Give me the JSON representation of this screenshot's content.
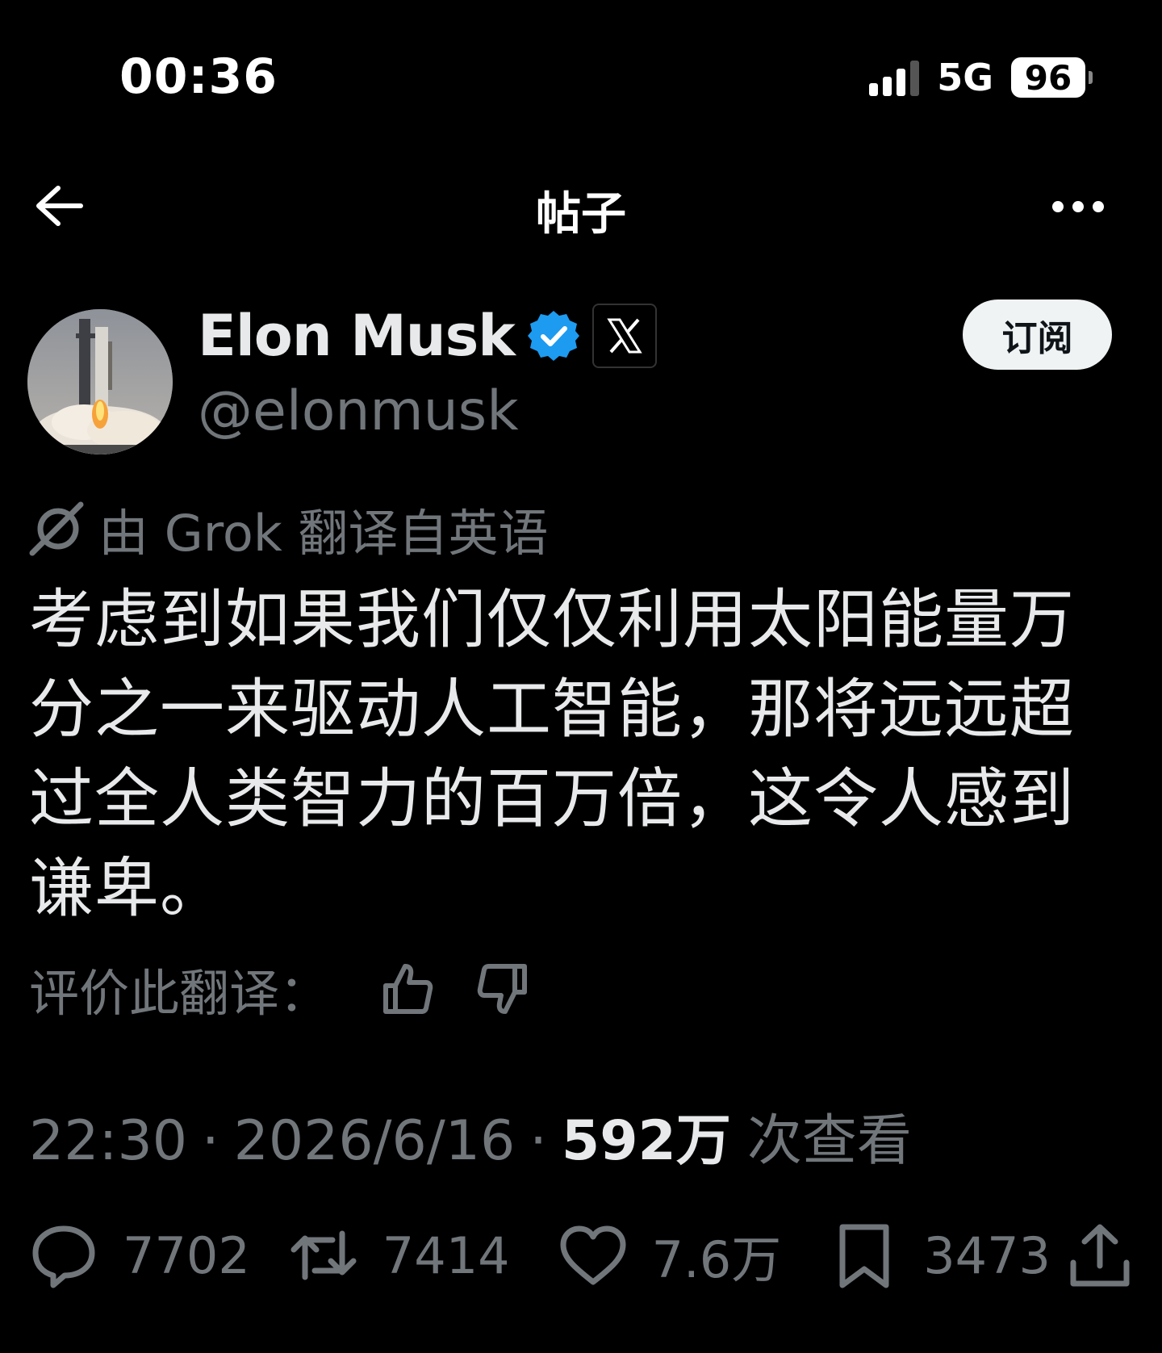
{
  "status_bar": {
    "time": "00:36",
    "network": "5G",
    "battery": "96"
  },
  "nav": {
    "title": "帖子"
  },
  "author": {
    "name": "Elon Musk",
    "handle": "@elonmusk",
    "verified": true
  },
  "subscribe_label": "订阅",
  "translation": {
    "note": "由 Grok 翻译自英语",
    "rate_label": "评价此翻译："
  },
  "post": {
    "text": "考虑到如果我们仅仅利用太阳能量万分之一来驱动人工智能，那将远远超过全人类智力的百万倍，这令人感到谦卑。"
  },
  "meta": {
    "time": "22:30",
    "date": "2026/6/16",
    "views_count": "592万",
    "views_label": "次查看"
  },
  "actions": {
    "replies": "7702",
    "reposts": "7414",
    "likes": "7.6万",
    "bookmarks": "3473"
  },
  "colors": {
    "background": "#000000",
    "text": "#e7e9ea",
    "secondary": "#71767b",
    "verified_blue": "#1d9bf0"
  }
}
